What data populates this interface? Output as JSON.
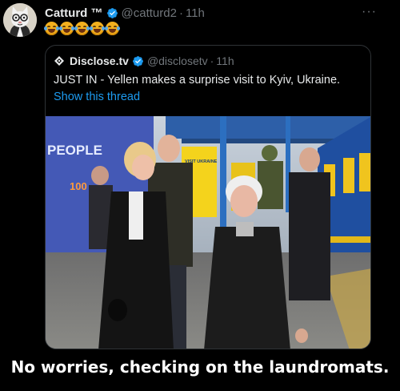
{
  "tweet": {
    "author_name": "Catturd ™",
    "handle": "@catturd2",
    "separator": "·",
    "time": "11h",
    "more_label": "···",
    "emoji_count": 5,
    "emoji_icon": "face-with-tears-of-joy-icon"
  },
  "quote": {
    "author_name": "Disclose.tv",
    "handle": "@disclosetv",
    "separator": "·",
    "time": "11h",
    "text": "JUST IN - Yellen makes a surprise visit to Kyiv, Ukraine.",
    "thread_link": "Show this thread",
    "photo": {
      "banner_text": "PEOPLE",
      "banner_number": "100",
      "sign_text": "VISIT UKRAINE"
    }
  },
  "caption": "No worries, checking on the laundromats.",
  "colors": {
    "background": "#000000",
    "text": "#e7e9ea",
    "muted": "#71767b",
    "link": "#1d9bf0",
    "verified": "#1d9bf0",
    "border": "#2f3336"
  }
}
